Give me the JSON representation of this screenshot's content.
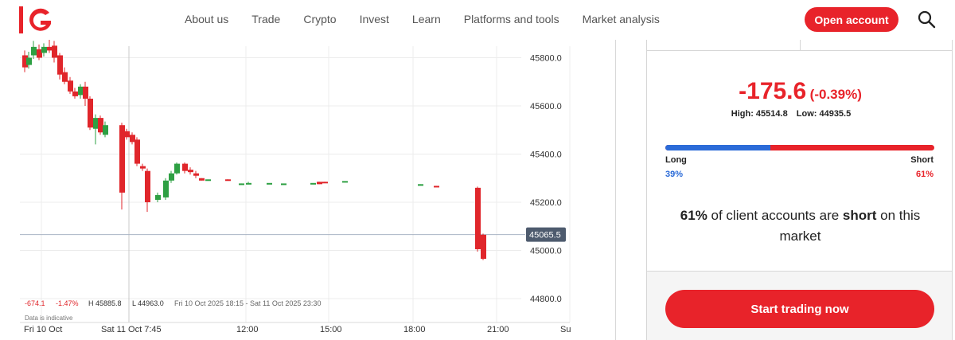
{
  "brand": {
    "logo_text": "IG",
    "accent": "#e8232a",
    "long_color": "#2b6bd8"
  },
  "nav": {
    "items": [
      {
        "label": "About us"
      },
      {
        "label": "Trade"
      },
      {
        "label": "Crypto"
      },
      {
        "label": "Invest"
      },
      {
        "label": "Learn"
      },
      {
        "label": "Platforms and tools"
      },
      {
        "label": "Market analysis"
      }
    ],
    "open_account": "Open account",
    "search_icon": "search-icon"
  },
  "chart": {
    "price_axis": [
      "45800.0",
      "45600.0",
      "45400.0",
      "45200.0",
      "45000.0",
      "44800.0"
    ],
    "current_price": "45065.5",
    "time_axis": [
      "Fri 10 Oct",
      "Sat 11 Oct 7:45",
      "12:00",
      "15:00",
      "18:00",
      "21:00",
      "Su"
    ],
    "stats": {
      "change": "-674.1",
      "change_pct": "-1.47%",
      "high": "H 45885.8",
      "low": "L 44963.0",
      "range": "Fri 10 Oct 2025 18:15 - Sat 11 Oct 2025 23:30"
    },
    "disclaimer": "Data is indicative",
    "candles": [
      {
        "o": 45810,
        "c": 45760,
        "h": 45830,
        "l": 45740
      },
      {
        "o": 45770,
        "c": 45800,
        "h": 45825,
        "l": 45755
      },
      {
        "o": 45810,
        "c": 45845,
        "h": 45870,
        "l": 45795
      },
      {
        "o": 45835,
        "c": 45800,
        "h": 45855,
        "l": 45790
      },
      {
        "o": 45820,
        "c": 45845,
        "h": 45860,
        "l": 45805
      },
      {
        "o": 45845,
        "c": 45830,
        "h": 45885,
        "l": 45820
      },
      {
        "o": 45850,
        "c": 45800,
        "h": 45870,
        "l": 45780
      },
      {
        "o": 45810,
        "c": 45730,
        "h": 45820,
        "l": 45710
      },
      {
        "o": 45740,
        "c": 45700,
        "h": 45760,
        "l": 45690
      },
      {
        "o": 45705,
        "c": 45660,
        "h": 45720,
        "l": 45650
      },
      {
        "o": 45660,
        "c": 45640,
        "h": 45675,
        "l": 45630
      },
      {
        "o": 45645,
        "c": 45680,
        "h": 45690,
        "l": 45630
      },
      {
        "o": 45680,
        "c": 45630,
        "h": 45700,
        "l": 45600
      },
      {
        "o": 45630,
        "c": 45510,
        "h": 45640,
        "l": 45500
      },
      {
        "o": 45505,
        "c": 45550,
        "h": 45565,
        "l": 45440
      },
      {
        "o": 45550,
        "c": 45490,
        "h": 45560,
        "l": 45480
      },
      {
        "o": 45480,
        "c": 45520,
        "h": 45535,
        "l": 45470
      },
      {
        "o": 45520,
        "c": 45240,
        "h": 45530,
        "l": 45170
      },
      {
        "o": 45495,
        "c": 45470,
        "h": 45505,
        "l": 45460
      },
      {
        "o": 45480,
        "c": 45450,
        "h": 45490,
        "l": 45440
      },
      {
        "o": 45460,
        "c": 45360,
        "h": 45470,
        "l": 45350
      },
      {
        "o": 45350,
        "c": 45340,
        "h": 45360,
        "l": 45330
      },
      {
        "o": 45330,
        "c": 45200,
        "h": 45340,
        "l": 45160
      },
      {
        "o": 45210,
        "c": 45230,
        "h": 45240,
        "l": 45200
      },
      {
        "o": 45220,
        "c": 45290,
        "h": 45300,
        "l": 45210
      },
      {
        "o": 45290,
        "c": 45320,
        "h": 45330,
        "l": 45280
      },
      {
        "o": 45320,
        "c": 45360,
        "h": 45365,
        "l": 45315
      },
      {
        "o": 45360,
        "c": 45330,
        "h": 45365,
        "l": 45320
      },
      {
        "o": 45335,
        "c": 45325,
        "h": 45345,
        "l": 45315
      },
      {
        "o": 45320,
        "c": 45310,
        "h": 45330,
        "l": 45300
      },
      {
        "o": 45300,
        "c": 45290,
        "h": 45300,
        "l": 45290
      },
      {
        "o": 45295,
        "c": 45295,
        "h": 45295,
        "l": 45295
      },
      {
        "o": 45295,
        "c": 45293,
        "h": 45295,
        "l": 45293
      },
      {
        "o": 45275,
        "c": 45278,
        "h": 45278,
        "l": 45275
      },
      {
        "o": 45280,
        "c": 45280,
        "h": 45285,
        "l": 45275
      },
      {
        "o": 45280,
        "c": 45280,
        "h": 45280,
        "l": 45280
      },
      {
        "o": 45278,
        "c": 45278,
        "h": 45278,
        "l": 45278
      },
      {
        "o": 45280,
        "c": 45280,
        "h": 45280,
        "l": 45280
      },
      {
        "o": 45285,
        "c": 45275,
        "h": 45285,
        "l": 45275
      },
      {
        "o": 45285,
        "c": 45280,
        "h": 45285,
        "l": 45280
      },
      {
        "o": 45288,
        "c": 45288,
        "h": 45288,
        "l": 45288
      },
      {
        "o": 45272,
        "c": 45275,
        "h": 45275,
        "l": 45272
      },
      {
        "o": 45268,
        "c": 45265,
        "h": 45268,
        "l": 45265
      },
      {
        "o": 45260,
        "c": 45005,
        "h": 45265,
        "l": 44995
      },
      {
        "o": 45065,
        "c": 44965,
        "h": 45070,
        "l": 44960
      }
    ]
  },
  "panel": {
    "change_value": "-175.6",
    "change_pct": "(-0.39%)",
    "high": "High: 45514.8",
    "low": "Low: 44935.5",
    "long_label": "Long",
    "short_label": "Short",
    "long_pct": "39%",
    "short_pct": "61%",
    "long_fraction": 0.39,
    "sentence_pct": "61%",
    "sentence_mid": " of client accounts are ",
    "sentence_word": "short",
    "sentence_end": " on this market",
    "cta": "Start trading now"
  }
}
